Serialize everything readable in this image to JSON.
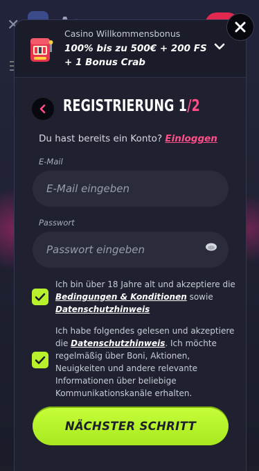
{
  "background": {
    "logo_text": "Ap"
  },
  "bonus": {
    "caption": "Casino Willkommensbonus",
    "title": "100% bis zu 500€ + 200 FS + 1 Bonus Crab"
  },
  "heading": {
    "title": "REGISTRIERUNG 1",
    "step_separator": "/",
    "step_total": "2"
  },
  "login": {
    "prompt": "Du hast bereits ein Konto?",
    "link": "Einloggen"
  },
  "email": {
    "label": "E-Mail",
    "placeholder": "E-Mail eingeben",
    "value": ""
  },
  "password": {
    "label": "Passwort",
    "placeholder": "Passwort eingeben",
    "value": ""
  },
  "consent_age": {
    "checked": true,
    "text_before": "Ich bin über 18 Jahre alt und akzeptiere die",
    "link_terms": "Bedingungen & Konditionen",
    "text_mid": "sowie",
    "link_privacy": "Datenschutzhinweis"
  },
  "consent_marketing": {
    "checked": true,
    "text_before": "Ich habe folgendes gelesen und akzeptiere die",
    "link_privacy": "Datenschutzhinweis",
    "text_after": ". Ich möchte regelmäßig über Boni, Aktionen, Neuigkeiten und andere relevante Informationen über beliebige Kommunikationskanäle erhalten."
  },
  "next_button": {
    "label": "NÄCHSTER SCHRITT"
  },
  "colors": {
    "accent_pink": "#ff4f8a",
    "accent_lime": "#b8f22c",
    "modal_bg": "#1f2130",
    "input_bg": "#2a2c3c"
  },
  "icons": [
    "close-icon",
    "slot-machine-icon",
    "chevron-down-icon",
    "back-arrow-icon",
    "eye-icon",
    "checkmark-icon"
  ]
}
